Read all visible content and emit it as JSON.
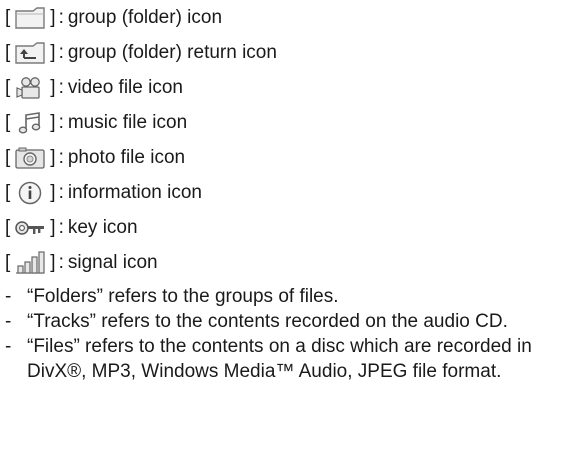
{
  "icon_legend": [
    {
      "icon": "folder-icon",
      "open_bracket": "[",
      "close_bracket": "]",
      "separator": ":",
      "description": "group (folder) icon"
    },
    {
      "icon": "folder-return-icon",
      "open_bracket": "[",
      "close_bracket": "]",
      "separator": ":",
      "description": "group (folder) return icon"
    },
    {
      "icon": "video-file-icon",
      "open_bracket": "[",
      "close_bracket": "]",
      "separator": ":",
      "description": "video file icon"
    },
    {
      "icon": "music-file-icon",
      "open_bracket": "[",
      "close_bracket": "]",
      "separator": ":",
      "description": "music file icon"
    },
    {
      "icon": "photo-file-icon",
      "open_bracket": "[",
      "close_bracket": "]",
      "separator": ":",
      "description": "photo file icon"
    },
    {
      "icon": "information-icon",
      "open_bracket": "[",
      "close_bracket": "]",
      "separator": ":",
      "description": "information icon"
    },
    {
      "icon": "key-icon",
      "open_bracket": "[",
      "close_bracket": "]",
      "separator": ":",
      "description": "key icon"
    },
    {
      "icon": "signal-icon",
      "open_bracket": "[",
      "close_bracket": "]",
      "separator": ":",
      "description": "signal icon"
    }
  ],
  "notes": [
    {
      "bullet": "-",
      "text": "“Folders” refers to the groups of files."
    },
    {
      "bullet": "-",
      "text": "“Tracks” refers to the contents recorded on the audio CD."
    },
    {
      "bullet": "-",
      "text": "“Files” refers to the contents on a disc which are recorded in DivX®, MP3, Windows Media™ Audio, JPEG file format."
    }
  ]
}
